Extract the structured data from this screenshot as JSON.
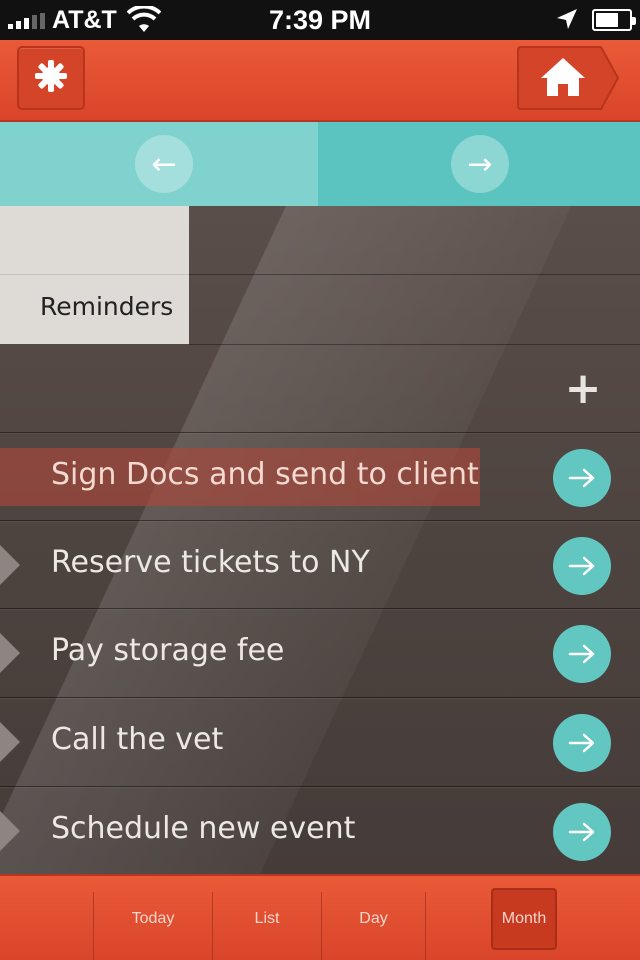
{
  "status_bar": {
    "carrier": "AT&T",
    "time": "7:39 PM",
    "battery_level": 0.7
  },
  "header": {
    "settings_icon": "gear-icon",
    "home_icon": "home-icon"
  },
  "nav": {
    "prev_icon": "←",
    "next_icon": "→"
  },
  "section": {
    "tab_label": "Reminders",
    "add_icon": "+"
  },
  "reminders": [
    {
      "label": "Sign Docs and send to client",
      "active": true
    },
    {
      "label": "Reserve tickets to NY",
      "active": false
    },
    {
      "label": "Pay storage fee",
      "active": false
    },
    {
      "label": "Call the vet",
      "active": false
    },
    {
      "label": "Schedule new event",
      "active": false
    }
  ],
  "tabs": [
    {
      "label": "Today"
    },
    {
      "label": "List"
    },
    {
      "label": "Day"
    },
    {
      "label": "Month",
      "selected": true
    }
  ],
  "colors": {
    "accent_orange": "#e0502f",
    "accent_teal": "#62c6c1",
    "background": "#4d433f"
  }
}
